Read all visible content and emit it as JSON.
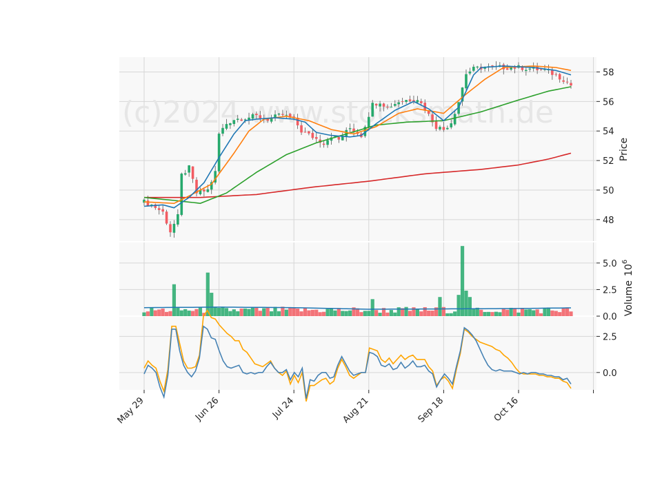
{
  "watermark": "(c)2024 www.stocksmath.de",
  "chart_data": [
    {
      "type": "candlestick",
      "panel": "price",
      "ylabel": "Price",
      "ylim": [
        46.5,
        59.0
      ],
      "yticks": [
        48,
        50,
        52,
        54,
        56,
        58
      ],
      "x_tick_labels": [
        "May 29",
        "Jun 26",
        "Jul 24",
        "Aug 21",
        "Sep 18",
        "Oct 16"
      ],
      "grid": true,
      "colors": {
        "up": "#26a96c",
        "down": "#f25c62",
        "ma1": "#1f77b4",
        "ma2": "#ff7f0e",
        "ma3": "#2ca02c",
        "ma4": "#d62728"
      },
      "close_keyframes": [
        [
          0,
          49.2
        ],
        [
          2,
          49.0
        ],
        [
          5,
          48.5
        ],
        [
          7,
          47.2
        ],
        [
          9,
          48.2
        ],
        [
          10,
          51.0
        ],
        [
          12,
          51.5
        ],
        [
          14,
          49.8
        ],
        [
          17,
          50.0
        ],
        [
          19,
          51.2
        ],
        [
          20,
          53.8
        ],
        [
          22,
          54.5
        ],
        [
          24,
          54.8
        ],
        [
          27,
          54.9
        ],
        [
          30,
          55.0
        ],
        [
          33,
          54.8
        ],
        [
          37,
          55.1
        ],
        [
          40,
          54.8
        ],
        [
          42,
          54.0
        ],
        [
          45,
          53.6
        ],
        [
          48,
          53.2
        ],
        [
          50,
          53.7
        ],
        [
          52,
          53.4
        ],
        [
          55,
          54.2
        ],
        [
          58,
          53.7
        ],
        [
          61,
          55.8
        ],
        [
          63,
          56.0
        ],
        [
          65,
          55.6
        ],
        [
          68,
          56.0
        ],
        [
          70,
          56.1
        ],
        [
          73,
          56.2
        ],
        [
          75,
          55.5
        ],
        [
          78,
          54.3
        ],
        [
          80,
          54.1
        ],
        [
          82,
          54.6
        ],
        [
          84,
          56.0
        ],
        [
          86,
          57.9
        ],
        [
          88,
          58.2
        ],
        [
          90,
          58.3
        ],
        [
          95,
          58.3
        ],
        [
          100,
          58.3
        ],
        [
          104,
          58.2
        ],
        [
          107,
          58.1
        ],
        [
          110,
          57.8
        ],
        [
          112,
          57.5
        ],
        [
          114,
          57.1
        ]
      ],
      "ma_keyframes": {
        "ma1": [
          [
            0,
            48.9
          ],
          [
            5,
            49.0
          ],
          [
            8,
            48.8
          ],
          [
            12,
            49.5
          ],
          [
            16,
            50.5
          ],
          [
            20,
            52.2
          ],
          [
            24,
            53.8
          ],
          [
            27,
            54.7
          ],
          [
            30,
            54.8
          ],
          [
            35,
            54.9
          ],
          [
            40,
            54.8
          ],
          [
            43,
            54.6
          ],
          [
            46,
            53.9
          ],
          [
            50,
            53.7
          ],
          [
            55,
            53.6
          ],
          [
            58,
            53.7
          ],
          [
            62,
            54.5
          ],
          [
            67,
            55.4
          ],
          [
            72,
            56.0
          ],
          [
            76,
            55.5
          ],
          [
            80,
            54.7
          ],
          [
            84,
            55.6
          ],
          [
            88,
            57.8
          ],
          [
            90,
            58.3
          ],
          [
            96,
            58.4
          ],
          [
            104,
            58.3
          ],
          [
            110,
            58.1
          ],
          [
            114,
            57.8
          ]
        ],
        "ma2": [
          [
            0,
            49.2
          ],
          [
            8,
            49.1
          ],
          [
            12,
            49.6
          ],
          [
            18,
            50.4
          ],
          [
            24,
            52.5
          ],
          [
            28,
            54.0
          ],
          [
            32,
            54.8
          ],
          [
            38,
            55.0
          ],
          [
            44,
            54.7
          ],
          [
            50,
            54.1
          ],
          [
            56,
            53.8
          ],
          [
            62,
            54.3
          ],
          [
            68,
            55.2
          ],
          [
            73,
            55.5
          ],
          [
            80,
            55.2
          ],
          [
            86,
            56.5
          ],
          [
            91,
            57.5
          ],
          [
            96,
            58.3
          ],
          [
            104,
            58.4
          ],
          [
            110,
            58.3
          ],
          [
            114,
            58.1
          ]
        ],
        "ma3": [
          [
            0,
            49.5
          ],
          [
            8,
            49.3
          ],
          [
            15,
            49.1
          ],
          [
            22,
            49.8
          ],
          [
            30,
            51.2
          ],
          [
            38,
            52.4
          ],
          [
            46,
            53.2
          ],
          [
            54,
            53.8
          ],
          [
            62,
            54.4
          ],
          [
            70,
            54.6
          ],
          [
            80,
            54.7
          ],
          [
            90,
            55.3
          ],
          [
            100,
            56.1
          ],
          [
            108,
            56.7
          ],
          [
            114,
            57.0
          ]
        ],
        "ma4": [
          [
            0,
            49.5
          ],
          [
            15,
            49.5
          ],
          [
            30,
            49.7
          ],
          [
            45,
            50.2
          ],
          [
            60,
            50.6
          ],
          [
            75,
            51.1
          ],
          [
            90,
            51.4
          ],
          [
            100,
            51.7
          ],
          [
            108,
            52.1
          ],
          [
            114,
            52.5
          ]
        ]
      }
    },
    {
      "type": "bar",
      "panel": "volume",
      "ylabel": "Volume",
      "unit_label": "10",
      "unit_exp": "6",
      "ylim": [
        0,
        7.0
      ],
      "yticks": [
        0.0,
        2.5,
        5.0
      ],
      "ytick_labels": [
        "0.0",
        "2.5",
        "5.0"
      ],
      "grid": true,
      "spikes": [
        [
          8,
          3.0
        ],
        [
          17,
          4.1
        ],
        [
          18,
          2.2
        ],
        [
          61,
          1.6
        ],
        [
          79,
          1.8
        ],
        [
          84,
          2.0
        ],
        [
          85,
          6.6
        ],
        [
          86,
          2.4
        ],
        [
          87,
          1.8
        ]
      ],
      "avg_keyframes": [
        [
          0,
          0.8
        ],
        [
          20,
          0.85
        ],
        [
          40,
          0.8
        ],
        [
          60,
          0.65
        ],
        [
          80,
          0.68
        ],
        [
          100,
          0.72
        ],
        [
          114,
          0.78
        ]
      ]
    },
    {
      "type": "line",
      "panel": "oscillator",
      "ylim": [
        -1.2,
        3.9
      ],
      "yticks": [
        0.0,
        2.5
      ],
      "ytick_labels": [
        "0.0",
        "2.5"
      ],
      "grid": true,
      "series": [
        {
          "color": "#4682b4",
          "values": [
            -0.1,
            0.5,
            0.3,
            0.0,
            -1.0,
            -1.7,
            -0.2,
            3.0,
            3.0,
            1.5,
            0.5,
            0.0,
            -0.3,
            0.1,
            1.0,
            3.2,
            3.0,
            2.4,
            2.3,
            1.5,
            0.8,
            0.4,
            0.3,
            0.4,
            0.5,
            0.0,
            -0.1,
            0.0,
            -0.1,
            0.0,
            0.0,
            0.4,
            0.7,
            0.3,
            0.0,
            0.0,
            0.2,
            -0.5,
            0.0,
            -0.3,
            0.3,
            -1.8,
            -0.5,
            -0.6,
            -0.2,
            0.0,
            0.0,
            -0.4,
            -0.3,
            0.5,
            1.1,
            0.6,
            0.1,
            -0.2,
            -0.1,
            0.0,
            0.0,
            1.4,
            1.3,
            1.1,
            0.5,
            0.4,
            0.6,
            0.2,
            0.3,
            0.7,
            0.3,
            0.5,
            0.8,
            0.4,
            0.4,
            0.5,
            0.1,
            -0.1,
            -1.0,
            -0.5,
            -0.1,
            -0.4,
            -0.8,
            0.4,
            1.5,
            3.1,
            2.9,
            2.6,
            2.2,
            1.6,
            1.0,
            0.5,
            0.2,
            0.1,
            0.2,
            0.1,
            0.1,
            0.1,
            0.0,
            -0.1,
            0.0,
            -0.1,
            0.0,
            0.0,
            -0.1,
            -0.1,
            -0.2,
            -0.2,
            -0.3,
            -0.3,
            -0.5,
            -0.4,
            -0.8
          ]
        },
        {
          "color": "#ffa500",
          "values": [
            0.3,
            0.8,
            0.5,
            0.3,
            -0.6,
            -1.3,
            0.2,
            3.2,
            3.2,
            2.0,
            0.8,
            0.3,
            0.3,
            0.4,
            1.2,
            3.9,
            4.3,
            3.8,
            3.7,
            3.3,
            3.0,
            2.7,
            2.5,
            2.2,
            2.2,
            1.6,
            1.4,
            1.0,
            0.6,
            0.5,
            0.4,
            0.6,
            0.8,
            0.3,
            0.0,
            -0.2,
            0.1,
            -0.8,
            -0.2,
            -0.7,
            0.0,
            -2.0,
            -0.9,
            -0.9,
            -0.7,
            -0.5,
            -0.4,
            -0.8,
            -0.6,
            0.3,
            0.9,
            0.4,
            -0.2,
            -0.4,
            -0.2,
            0.0,
            0.0,
            1.7,
            1.6,
            1.5,
            0.9,
            0.7,
            1.0,
            0.6,
            0.9,
            1.2,
            0.9,
            1.1,
            1.2,
            0.9,
            0.9,
            0.9,
            0.4,
            0.1,
            -0.9,
            -0.5,
            -0.3,
            -0.6,
            -1.1,
            0.2,
            1.3,
            3.0,
            2.8,
            2.5,
            2.3,
            2.1,
            2.0,
            1.9,
            1.8,
            1.6,
            1.5,
            1.2,
            1.0,
            0.7,
            0.3,
            0.0,
            -0.1,
            -0.1,
            -0.1,
            -0.1,
            -0.2,
            -0.2,
            -0.3,
            -0.3,
            -0.4,
            -0.4,
            -0.6,
            -0.7,
            -1.1
          ]
        }
      ]
    }
  ]
}
